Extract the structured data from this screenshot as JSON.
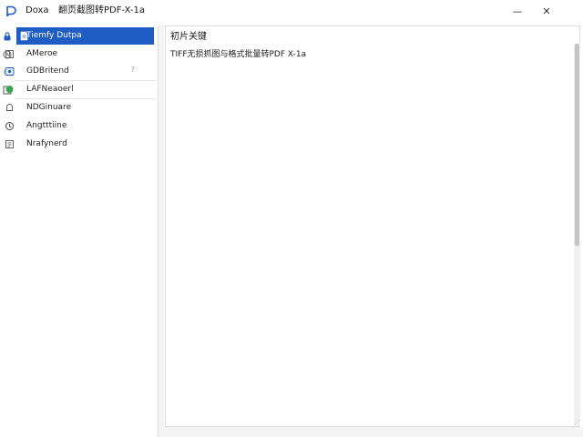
{
  "window": {
    "app_name": "Doxa",
    "document_title": "翻页截图转PDF-X-1a",
    "minimize_glyph": "—",
    "close_glyph": "✕",
    "accent_color": "#1f5cc4"
  },
  "rail": {
    "icons": [
      "lock-icon",
      "clock-icon",
      "status-dot-icon",
      "checkbox-icon"
    ]
  },
  "sidebar": {
    "items": [
      {
        "label": "Tiemfy Dutpa",
        "icon": "document-icon",
        "selected": true
      },
      {
        "label": "AMeroe",
        "icon": "book-icon",
        "selected": false
      },
      {
        "label": "GDBritend",
        "icon": "image-icon",
        "selected": false,
        "extra": "?"
      },
      {
        "label": "LAFNeaoerl",
        "icon": "chat-bubble-icon",
        "selected": false
      },
      {
        "label": "NDGinuare",
        "icon": "bell-icon",
        "selected": false
      },
      {
        "label": "Angtttiine",
        "icon": "clock-icon",
        "selected": false
      },
      {
        "label": "Nrafynerd",
        "icon": "list-icon",
        "selected": false
      }
    ]
  },
  "content": {
    "title": "初片关键",
    "text": "TIFF无损抓图与格式批量转PDF X-1a"
  },
  "resize_glyph": "⋰"
}
